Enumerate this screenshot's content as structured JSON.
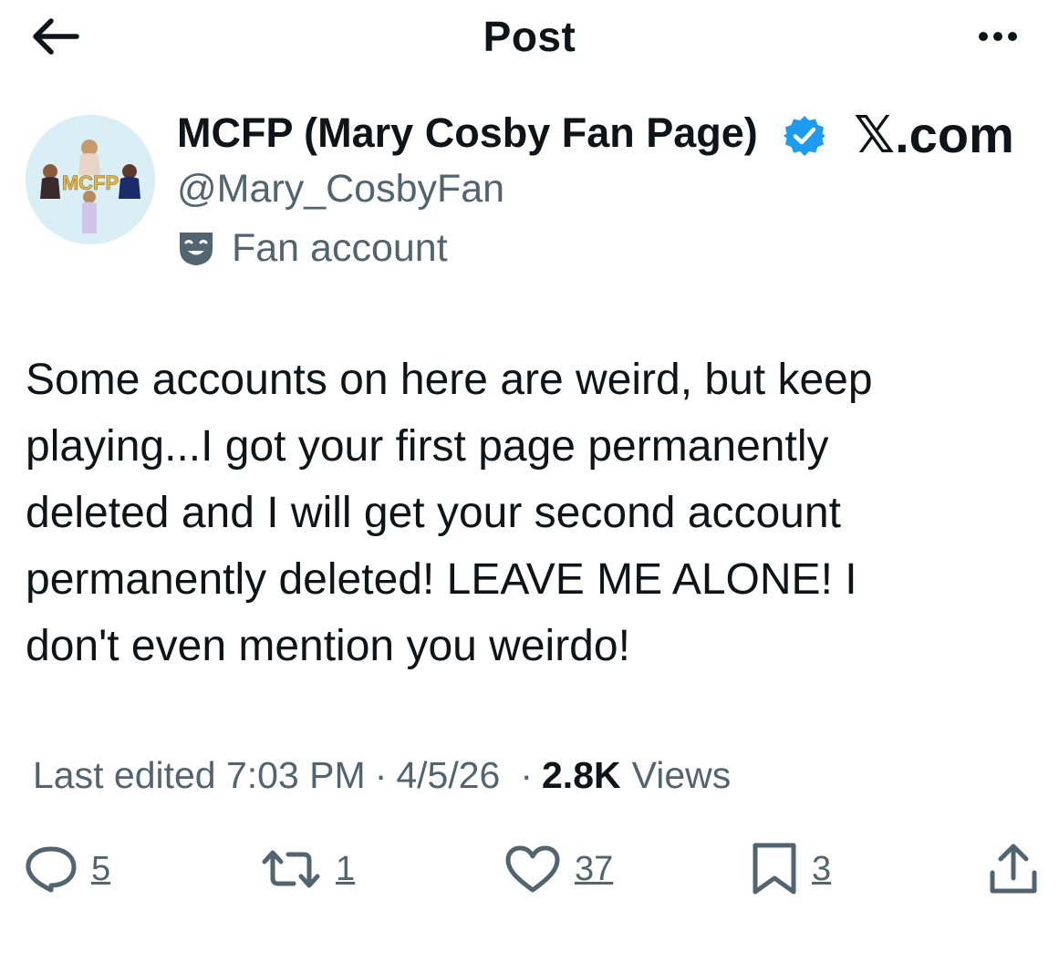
{
  "header": {
    "title": "Post",
    "back_icon": "arrow-left-icon",
    "more_icon": "more-horizontal-icon"
  },
  "author": {
    "name": "MCFP (Mary Cosby Fan Page)",
    "handle": "@Mary_CosbyFan",
    "label": "Fan account",
    "avatar_text": "MCFP",
    "verified": true,
    "verified_color": "#1d9bf0"
  },
  "watermark": "𝕏.com",
  "post": {
    "text": "Some accounts on here are weird, but keep\nplaying...I got your first page permanently\ndeleted and I will get your second account\npermanently deleted! LEAVE ME ALONE! I\ndon't even mention you weirdo!"
  },
  "meta": {
    "edited": "Last edited 7:03 PM",
    "separator": "·",
    "date": "4/5/26",
    "views_count": "2.8K",
    "views_label": "Views"
  },
  "actions": {
    "replies": "5",
    "reposts": "1",
    "likes": "37",
    "bookmarks": "3"
  },
  "colors": {
    "text_primary": "#0f1419",
    "text_secondary": "#536471",
    "accent": "#1d9bf0"
  }
}
